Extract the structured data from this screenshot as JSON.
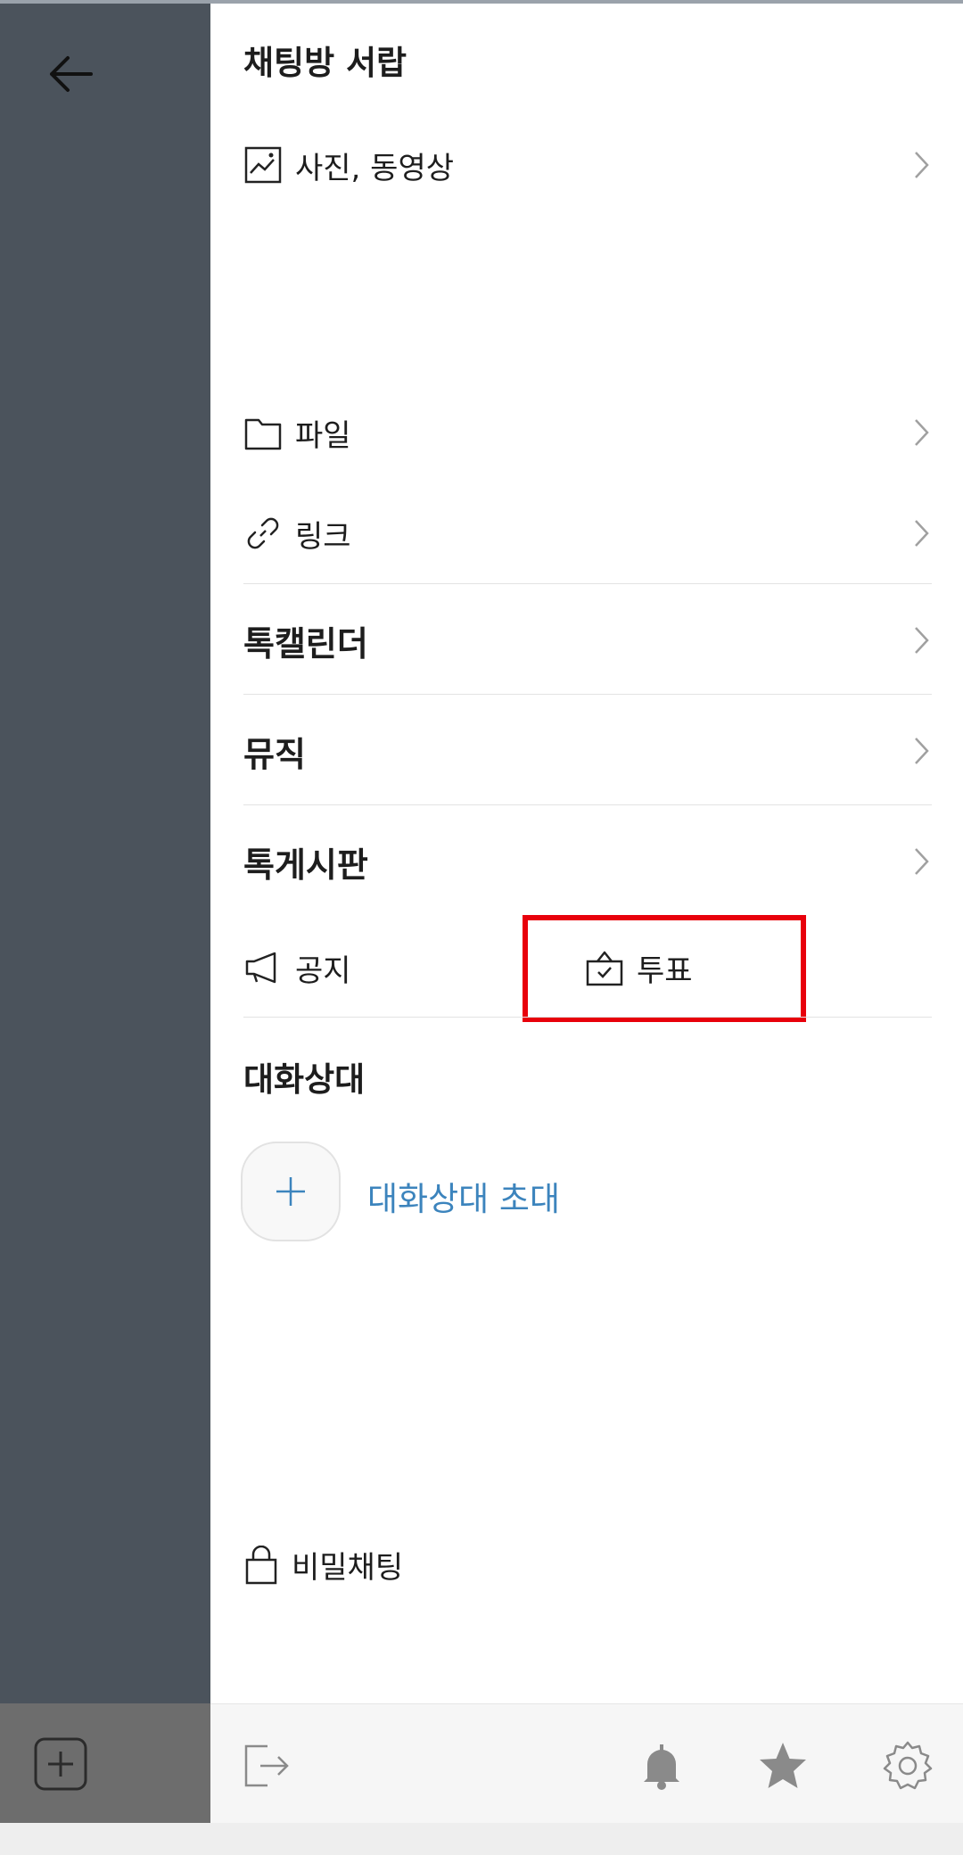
{
  "drawer": {
    "title": "채팅방 서랍",
    "items": {
      "media": "사진, 동영상",
      "file": "파일",
      "link": "링크"
    },
    "features": {
      "calendar": "톡캘린더",
      "music": "뮤직",
      "board": "톡게시판"
    },
    "quick": {
      "notice": "공지",
      "vote": "투표"
    },
    "members": {
      "title": "대화상대",
      "invite": "대화상대 초대"
    },
    "secret_chat": "비밀채팅"
  },
  "colors": {
    "highlight": "#e8000b",
    "link_blue": "#3c84bd",
    "backdrop": "#4b535c"
  },
  "icons": [
    "back-arrow-icon",
    "compose-icon",
    "image-icon",
    "folder-icon",
    "link-icon",
    "megaphone-icon",
    "ballot-icon",
    "plus-icon",
    "lock-icon",
    "exit-icon",
    "bell-icon",
    "star-icon",
    "gear-icon",
    "chevron-right-icon"
  ]
}
